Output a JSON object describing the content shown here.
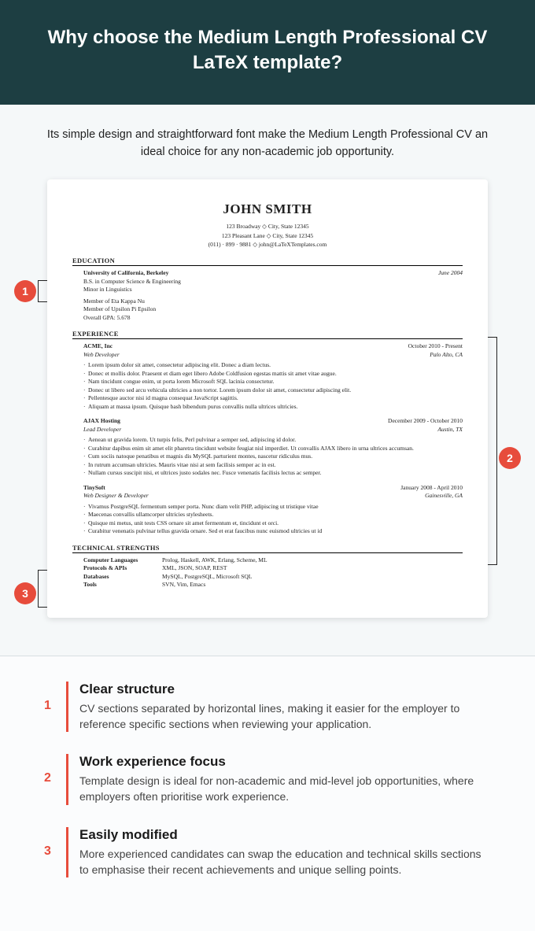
{
  "header": {
    "title": "Why choose the Medium Length Professional CV LaTeX template?"
  },
  "intro": "Its simple design and straightforward font make the Medium Length Professional CV an ideal choice for any non-academic job opportunity.",
  "cv": {
    "name": "JOHN SMITH",
    "addr1": "123 Broadway ◇ City, State 12345",
    "addr2": "123 Pleasant Lane ◇ City, State 12345",
    "contact": "(011) · 899 · 9881 ◇ john@LaTeXTemplates.com",
    "edu_title": "EDUCATION",
    "edu_school": "University of California, Berkeley",
    "edu_date": "June 2004",
    "edu_degree": "B.S. in Computer Science & Engineering",
    "edu_minor": "Minor in Linguistics",
    "edu_m1": "Member of Eta Kappa Nu",
    "edu_m2": "Member of Upsilon Pi Epsilon",
    "edu_gpa": "Overall GPA: 5.678",
    "exp_title": "EXPERIENCE",
    "jobs": [
      {
        "company": "ACME, Inc",
        "dates": "October 2010 - Present",
        "role": "Web Developer",
        "loc": "Palo Alto, CA",
        "bullets": [
          "Lorem ipsum dolor sit amet, consectetur adipiscing elit. Donec a diam lectus.",
          "Donec et mollis dolor. Praesent et diam eget libero Adobe Coldfusion egestas mattis sit amet vitae augue.",
          "Nam tincidunt congue enim, ut porta lorem Microsoft SQL lacinia consectetur.",
          "Donec ut libero sed arcu vehicula ultricies a non tortor. Lorem ipsum dolor sit amet, consectetur adipiscing elit.",
          "Pellentesque auctor nisi id magna consequat JavaScript sagittis.",
          "Aliquam at massa ipsum. Quisque bash bibendum purus convallis nulla ultrices ultricies."
        ]
      },
      {
        "company": "AJAX Hosting",
        "dates": "December 2009 - October 2010",
        "role": "Lead Developer",
        "loc": "Austin, TX",
        "bullets": [
          "Aenean ut gravida lorem. Ut turpis felis, Perl pulvinar a semper sed, adipiscing id dolor.",
          "Curabitur dapibus enim sit amet elit pharetra tincidunt website feugiat nisl imperdiet. Ut convallis AJAX libero in urna ultrices accumsan.",
          "Cum sociis natoque penatibus et magnis dis MySQL parturient montes, nascetur ridiculus mus.",
          "In rutrum accumsan ultricies. Mauris vitae nisi at sem facilisis semper ac in est.",
          "Nullam cursus suscipit nisi, et ultrices justo sodales nec. Fusce venenatis facilisis lectus ac semper."
        ]
      },
      {
        "company": "TinySoft",
        "dates": "January 2008 - April 2010",
        "role": "Web Designer & Developer",
        "loc": "Gainesville, GA",
        "bullets": [
          "Vivamus PostgreSQL fermentum semper porta. Nunc diam velit PHP, adipiscing ut tristique vitae",
          "Maecenas convallis ullamcorper ultricies stylesheets.",
          "Quisque mi metus, unit tests CSS ornare sit amet fermentum et, tincidunt et orci.",
          "Curabitur venenatis pulvinar tellus gravida ornare. Sed et erat faucibus nunc euismod ultricies ut id"
        ]
      }
    ],
    "tech_title": "TECHNICAL STRENGTHS",
    "tech": [
      {
        "k": "Computer Languages",
        "v": "Prolog, Haskell, AWK, Erlang, Scheme, ML"
      },
      {
        "k": "Protocols & APIs",
        "v": "XML, JSON, SOAP, REST"
      },
      {
        "k": "Databases",
        "v": "MySQL, PostgreSQL, Microsoft SQL"
      },
      {
        "k": "Tools",
        "v": "SVN, Vim, Emacs"
      }
    ]
  },
  "features": [
    {
      "num": "1",
      "title": "Clear structure",
      "desc": "CV sections separated by horizontal lines, making it easier for the employer to reference specific sections when reviewing your application."
    },
    {
      "num": "2",
      "title": "Work experience focus",
      "desc": "Template design is ideal for non-academic and mid-level job opportunities, where employers often prioritise work experience."
    },
    {
      "num": "3",
      "title": "Easily modified",
      "desc": "More experienced candidates can swap the education and technical skills sections to emphasise their recent achievements and unique selling points."
    }
  ]
}
